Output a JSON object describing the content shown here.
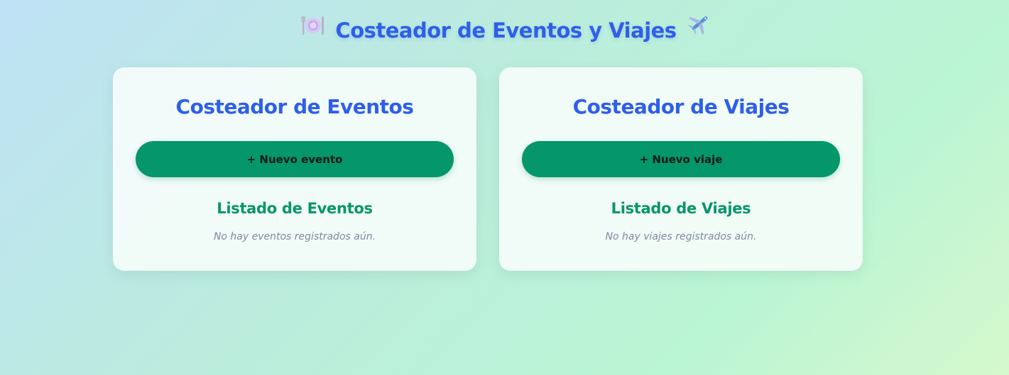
{
  "header": {
    "title": "Costeador de Eventos y Viajes",
    "left_icon": "plate-with-cutlery-icon",
    "right_icon": "airplane-icon"
  },
  "events_card": {
    "title": "Costeador de Eventos",
    "new_button_label": "+ Nuevo evento",
    "list_title": "Listado de Eventos",
    "empty_message": "No hay eventos registrados aún."
  },
  "trips_card": {
    "title": "Costeador de Viajes",
    "new_button_label": "+ Nuevo viaje",
    "list_title": "Listado de Viajes",
    "empty_message": "No hay viajes registrados aún."
  },
  "colors": {
    "primary_blue": "#2f5fe8",
    "primary_green": "#05966a",
    "muted_text": "#7d8aa0"
  }
}
